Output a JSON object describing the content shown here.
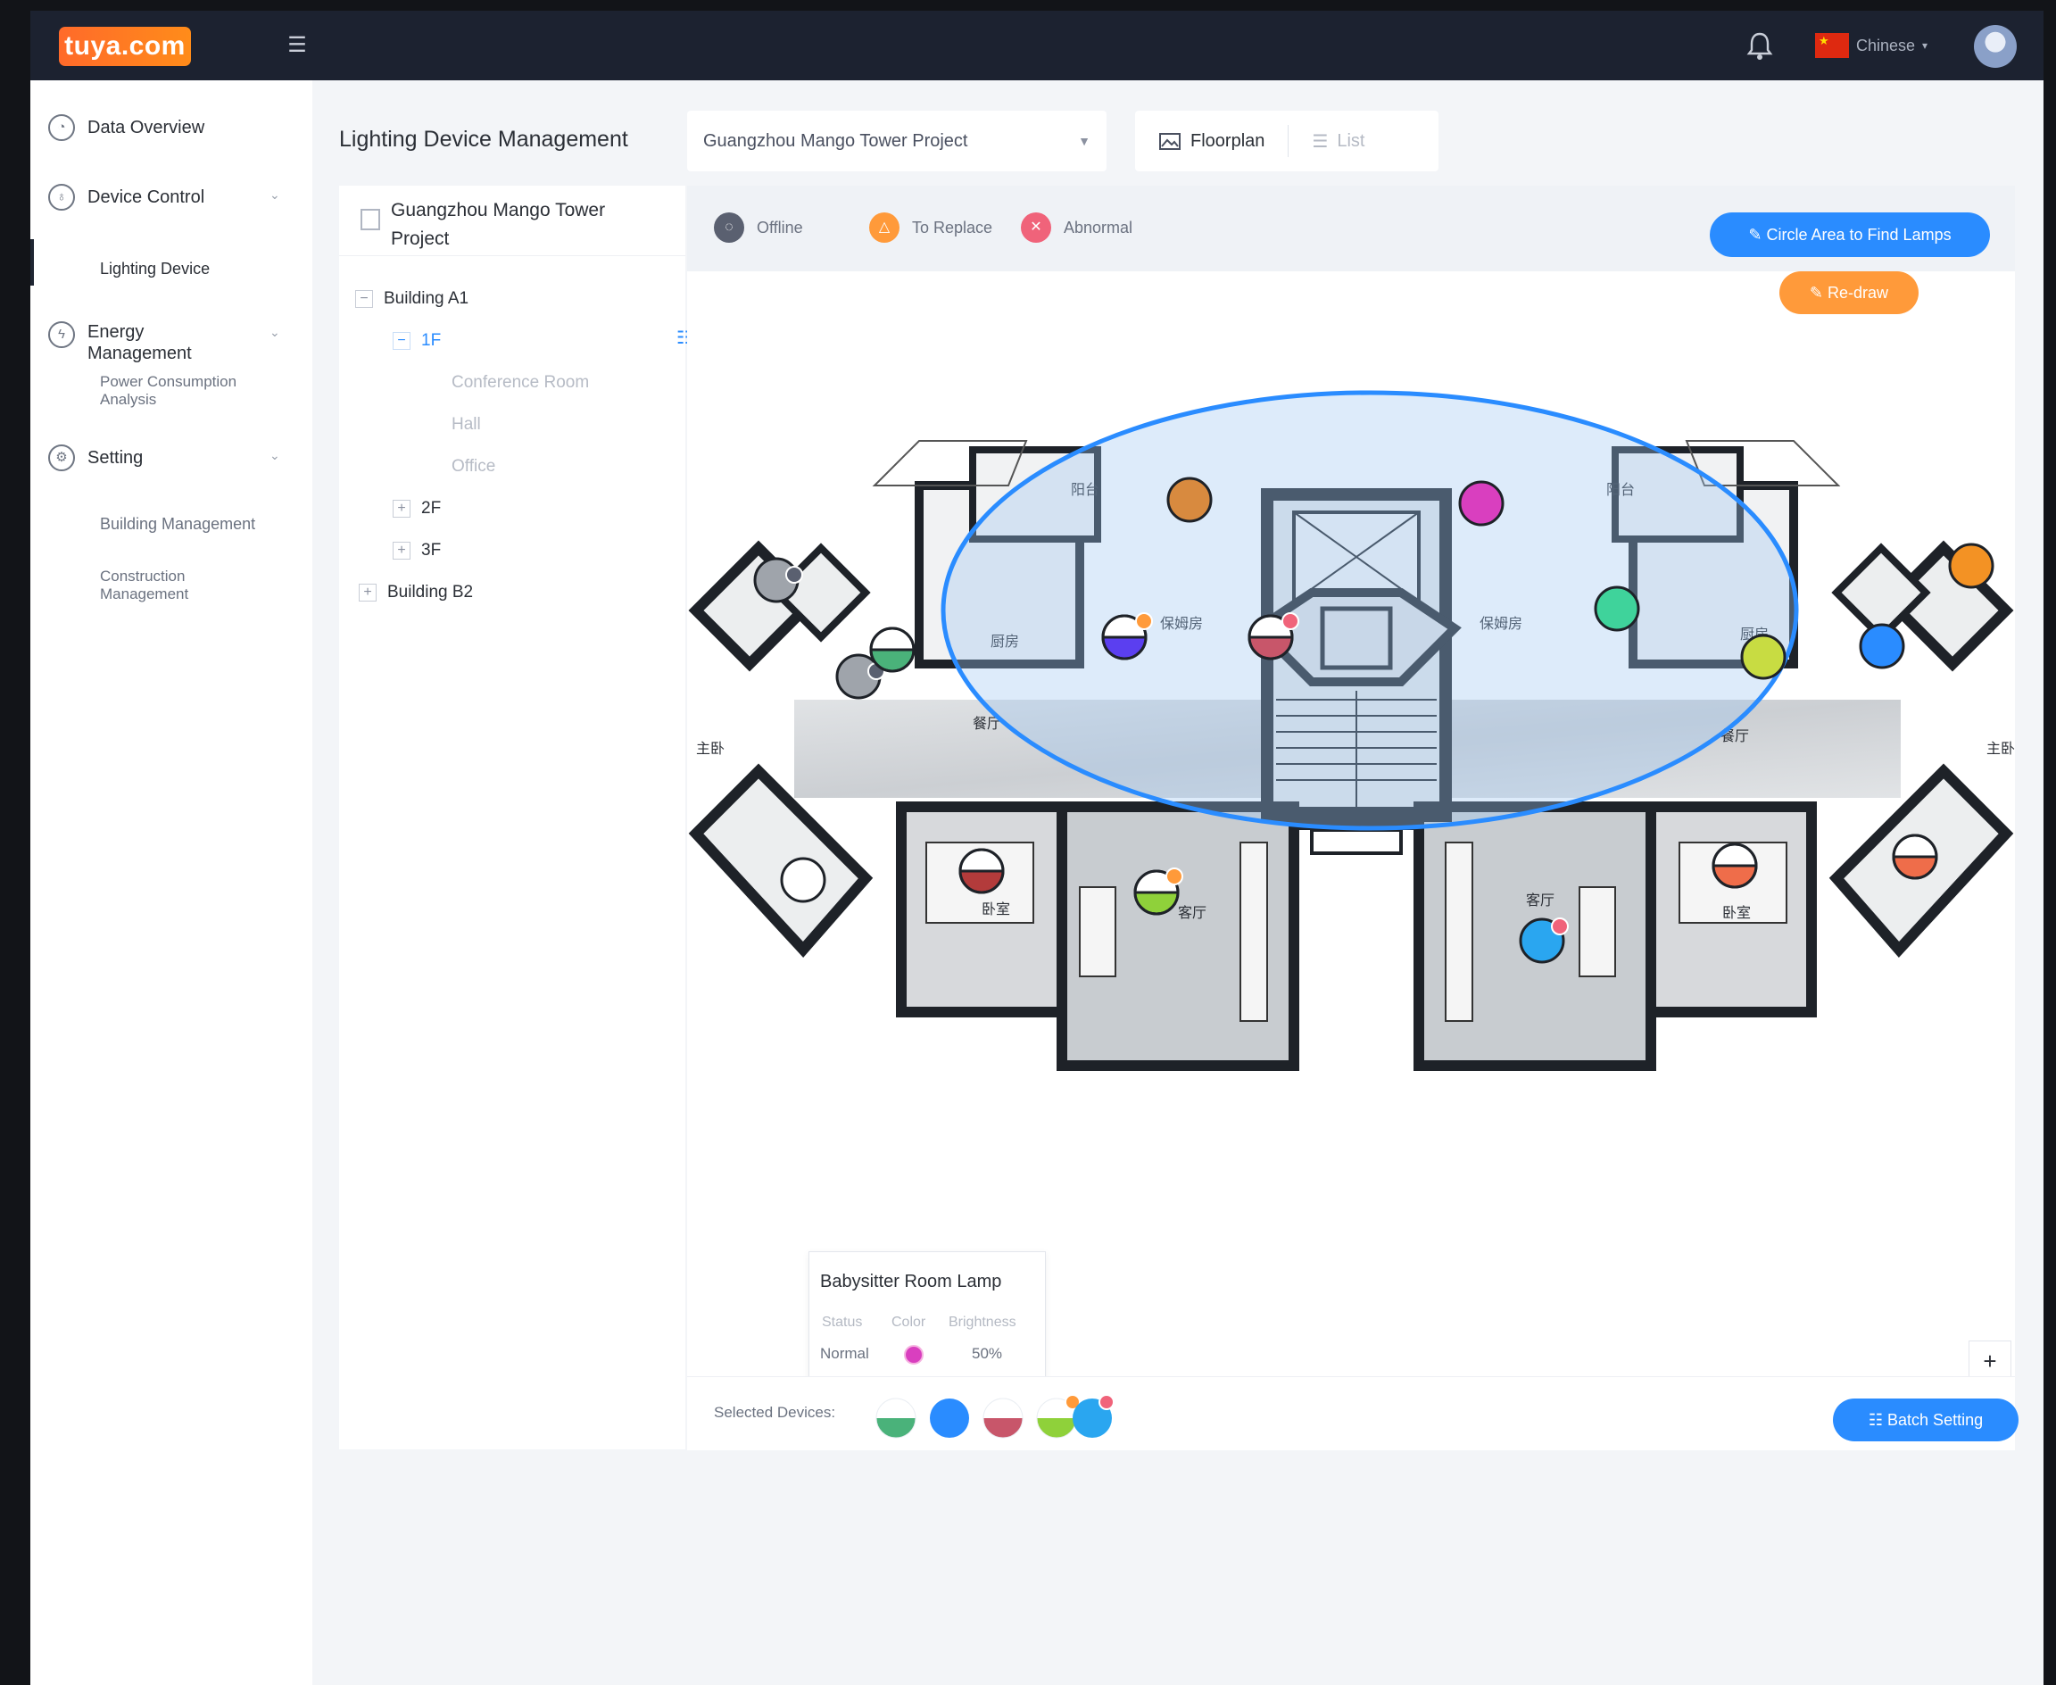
{
  "topbar": {
    "logo": "tuya.com",
    "language": "Chinese"
  },
  "sidebar": {
    "data_overview": "Data Overview",
    "device_control": "Device Control",
    "lighting_device": "Lighting Device",
    "energy_management": "Energy Management",
    "power_consumption": "Power Consumption Analysis",
    "setting": "Setting",
    "building_management": "Building Management",
    "construction_management": "Construction Management"
  },
  "header": {
    "title": "Lighting Device Management",
    "project": "Guangzhou Mango Tower Project",
    "floorplan": "Floorplan",
    "list": "List"
  },
  "tree": {
    "root": "Guangzhou Mango Tower Project",
    "building_a1": "Building A1",
    "floor_1f": "1F",
    "conference_room": "Conference Room",
    "hall": "Hall",
    "office": "Office",
    "floor_2f": "2F",
    "floor_3f": "3F",
    "building_b2": "Building B2"
  },
  "legend": {
    "offline": "Offline",
    "to_replace": "To Replace",
    "abnormal": "Abnormal"
  },
  "actions": {
    "circle_area": "Circle Area to Find Lamps",
    "redraw": "Re-draw",
    "batch_setting": "Batch Setting",
    "selected_devices": "Selected Devices:",
    "zoom_in": "+"
  },
  "tooltip": {
    "title": "Babysitter Room Lamp",
    "status_header": "Status",
    "color_header": "Color",
    "brightness_header": "Brightness",
    "status": "Normal",
    "brightness": "50%",
    "color": "#d93fbf"
  },
  "floorplan_labels": {
    "balcony": "阳台",
    "nanny_room": "保姆房",
    "kitchen": "厨房",
    "dining": "餐厅",
    "master_bedroom": "主卧",
    "bedroom": "卧室",
    "living_room": "客厅"
  },
  "colors": {
    "accent": "#2a8cff",
    "warning": "#ff9a3a",
    "abnormal": "#f0637a",
    "offline": "#5a6070"
  }
}
